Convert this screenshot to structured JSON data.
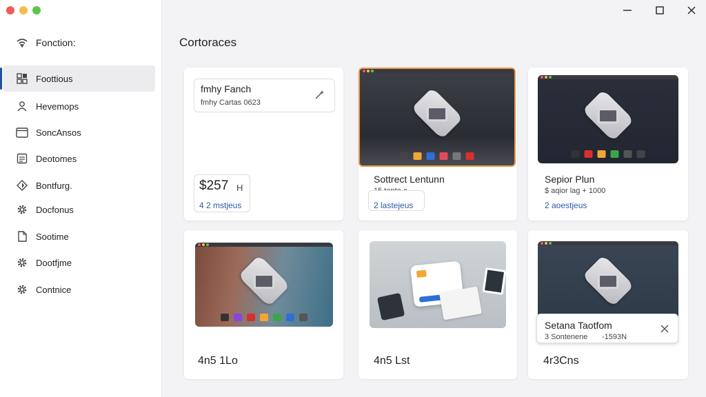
{
  "window": {
    "controls": {
      "minimize": "—",
      "maximize": "☐",
      "close": "✕"
    },
    "traffic_colors": [
      "#ec5f57",
      "#f4bd4f",
      "#5ec44d"
    ]
  },
  "sidebar": {
    "top_item": {
      "label": "Fonction:",
      "icon": "wifi-icon"
    },
    "items": [
      {
        "label": "Foottious",
        "icon": "apps-grid-icon",
        "active": true
      },
      {
        "label": "Hevemops",
        "icon": "person-icon"
      },
      {
        "label": "SoncAnsos",
        "icon": "window-icon"
      },
      {
        "label": "Deotomes",
        "icon": "document-icon"
      },
      {
        "label": "Bontfurg.",
        "icon": "diamond-icon"
      },
      {
        "label": "Docfonus",
        "icon": "gear-icon"
      },
      {
        "label": "Sootime",
        "icon": "file-icon"
      },
      {
        "label": "Dootfjme",
        "icon": "gear-icon"
      },
      {
        "label": "Contnice",
        "icon": "gear-icon"
      }
    ],
    "accent": "#1f4f9f"
  },
  "main": {
    "title": "Cortoraces",
    "cards": [
      {
        "search_title": "fmhy Fanch",
        "search_sub": "fmhy Cartas 0623",
        "search_icon": "magic-wand-icon",
        "stat_big": "$257",
        "stat_unit": "H",
        "stat_link": "4 2 mstjeus"
      },
      {
        "title": "Sottrect Lentunn",
        "sub": "15 tenta a",
        "link": "2 lastejeus"
      },
      {
        "title": "Sepior Plun",
        "sub": "$ aqior lag + 1000",
        "link": "2 aoestjeus"
      },
      {
        "bottom": "4n5 1Lo"
      },
      {
        "bottom": "4n5 Lst"
      },
      {
        "popup_title": "Setana Taotfom",
        "popup_sub_left": "3 Sontenene",
        "popup_sub_right": "-1593N",
        "popup_close": "✕",
        "bottom": "4r3Cns"
      }
    ]
  }
}
